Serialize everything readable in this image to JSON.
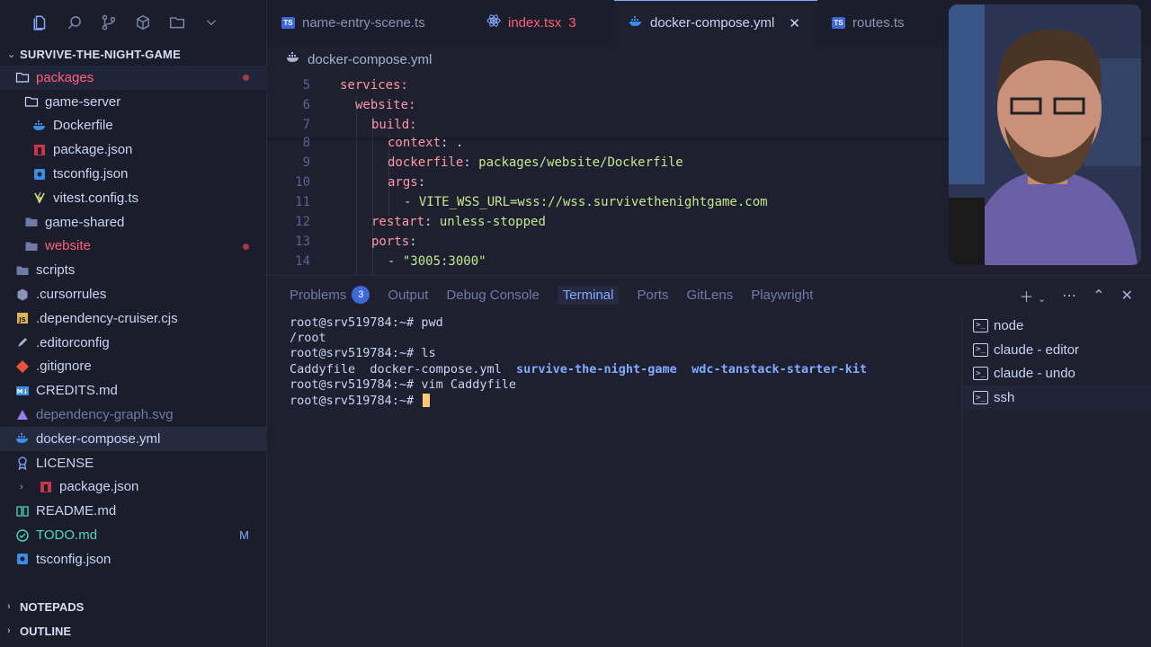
{
  "sidebar": {
    "project": "SURVIVE-THE-NIGHT-GAME",
    "tree": [
      {
        "label": "packages"
      },
      {
        "label": "game-server"
      },
      {
        "label": "Dockerfile"
      },
      {
        "label": "package.json"
      },
      {
        "label": "tsconfig.json"
      },
      {
        "label": "vitest.config.ts"
      },
      {
        "label": "game-shared"
      },
      {
        "label": "website"
      },
      {
        "label": "scripts"
      },
      {
        "label": ".cursorrules"
      },
      {
        "label": ".dependency-cruiser.cjs"
      },
      {
        "label": ".editorconfig"
      },
      {
        "label": ".gitignore"
      },
      {
        "label": "CREDITS.md"
      },
      {
        "label": "dependency-graph.svg"
      },
      {
        "label": "docker-compose.yml"
      },
      {
        "label": "LICENSE"
      },
      {
        "label": "package.json"
      },
      {
        "label": "README.md"
      },
      {
        "label": "TODO.md",
        "badge": "M"
      },
      {
        "label": "tsconfig.json"
      }
    ],
    "sections": {
      "notepads": "NOTEPADS",
      "outline": "OUTLINE"
    }
  },
  "tabs": [
    {
      "label": "name-entry-scene.ts",
      "icon": "ts"
    },
    {
      "label": "index.tsx",
      "badge": "3",
      "icon": "react"
    },
    {
      "label": "docker-compose.yml",
      "icon": "docker"
    },
    {
      "label": "routes.ts",
      "icon": "ts"
    }
  ],
  "breadcrumb": "docker-compose.yml",
  "editor": {
    "lines": [
      {
        "n": "5",
        "text": "services:"
      },
      {
        "n": "6",
        "text": "website:"
      },
      {
        "n": "7",
        "text": "build:"
      },
      {
        "n": "8",
        "key": "context",
        "val": "."
      },
      {
        "n": "9",
        "key": "dockerfile",
        "val": "packages/website/Dockerfile"
      },
      {
        "n": "10",
        "key": "args",
        "val": ""
      },
      {
        "n": "11",
        "val": "VITE_WSS_URL=wss://wss.survivethenightgame.com"
      },
      {
        "n": "12",
        "key": "restart",
        "val": "unless-stopped"
      },
      {
        "n": "13",
        "key": "ports",
        "val": ""
      },
      {
        "n": "14",
        "val": "\"3005:3000\""
      }
    ]
  },
  "panel": {
    "tabs": [
      {
        "label": "Problems",
        "badge": "3"
      },
      {
        "label": "Output"
      },
      {
        "label": "Debug Console"
      },
      {
        "label": "Terminal"
      },
      {
        "label": "Ports"
      },
      {
        "label": "GitLens"
      },
      {
        "label": "Playwright"
      }
    ],
    "terminal": {
      "prompt": "root@srv519784:~#",
      "cmd1": "pwd",
      "out1": "/root",
      "cmd2": "ls",
      "ls_files": [
        "Caddyfile",
        "docker-compose.yml"
      ],
      "ls_dirs": [
        "survive-the-night-game",
        "wdc-tanstack-starter-kit"
      ],
      "cmd3": "vim Caddyfile"
    },
    "terminals": [
      "node",
      "claude - editor",
      "claude - undo",
      "ssh"
    ]
  }
}
